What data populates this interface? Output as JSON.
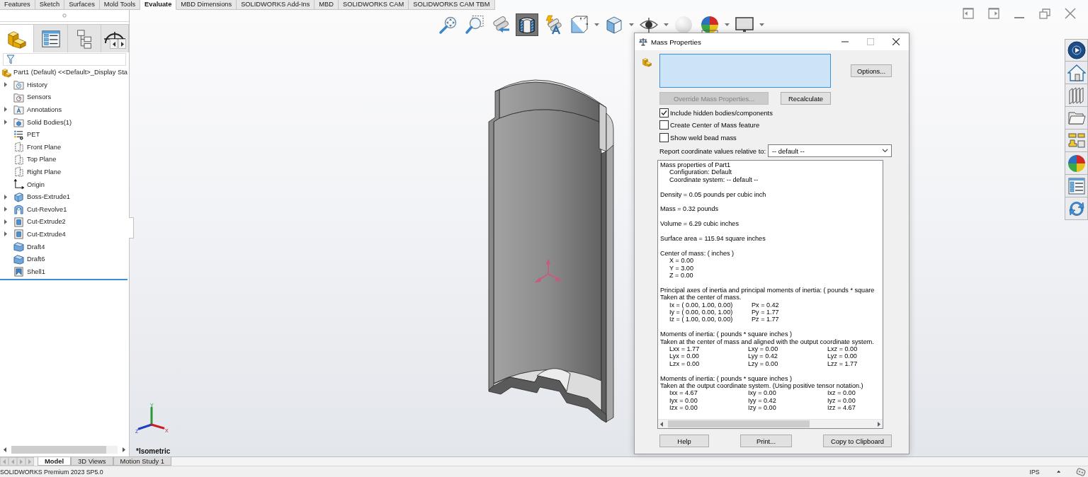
{
  "ribbon_tabs": [
    {
      "label": "Features",
      "selected": false
    },
    {
      "label": "Sketch",
      "selected": false
    },
    {
      "label": "Surfaces",
      "selected": false
    },
    {
      "label": "Mold Tools",
      "selected": false
    },
    {
      "label": "Evaluate",
      "selected": true
    },
    {
      "label": "MBD Dimensions",
      "selected": false
    },
    {
      "label": "SOLIDWORKS Add-Ins",
      "selected": false
    },
    {
      "label": "MBD",
      "selected": false
    },
    {
      "label": "SOLIDWORKS CAM",
      "selected": false
    },
    {
      "label": "SOLIDWORKS CAM TBM",
      "selected": false
    }
  ],
  "feature_panel": {
    "tabs": [
      {
        "kind": "features",
        "selected": true
      },
      {
        "kind": "properties",
        "selected": false
      },
      {
        "kind": "configurations",
        "selected": false
      },
      {
        "kind": "dimxpert",
        "selected": false
      }
    ],
    "root": {
      "label": "Part1 (Default) <<Default>_Display Sta"
    },
    "items": [
      {
        "label": "History",
        "kind": "history",
        "expanded": false
      },
      {
        "label": "Sensors",
        "kind": "sensors"
      },
      {
        "label": "Annotations",
        "kind": "annotations",
        "expanded": false
      },
      {
        "label": "Solid Bodies(1)",
        "kind": "bodies",
        "expanded": false
      },
      {
        "label": "PET",
        "kind": "material"
      },
      {
        "label": "Front Plane",
        "kind": "plane"
      },
      {
        "label": "Top Plane",
        "kind": "plane"
      },
      {
        "label": "Right Plane",
        "kind": "plane"
      },
      {
        "label": "Origin",
        "kind": "origin"
      },
      {
        "label": "Boss-Extrude1",
        "kind": "boss",
        "expanded": false
      },
      {
        "label": "Cut-Revolve1",
        "kind": "revolve",
        "expanded": false
      },
      {
        "label": "Cut-Extrude2",
        "kind": "cut",
        "expanded": false
      },
      {
        "label": "Cut-Extrude4",
        "kind": "cut",
        "expanded": false
      },
      {
        "label": "Draft4",
        "kind": "draft"
      },
      {
        "label": "Draft6",
        "kind": "draft"
      },
      {
        "label": "Shell1",
        "kind": "shell"
      }
    ]
  },
  "view_toolbar": [
    {
      "kind": "zoom_fit",
      "selected": false,
      "disabled": false,
      "menu": false
    },
    {
      "kind": "zoom_area",
      "selected": false,
      "disabled": false,
      "menu": false
    },
    {
      "kind": "previous_view",
      "selected": false,
      "disabled": false,
      "menu": false
    },
    {
      "kind": "section_view",
      "selected": true,
      "disabled": false,
      "menu": false
    },
    {
      "kind": "dynamic_annotation",
      "selected": false,
      "disabled": false,
      "menu": false
    },
    {
      "kind": "view_orientation",
      "selected": false,
      "disabled": false,
      "menu": true
    },
    {
      "kind": "display_style",
      "selected": false,
      "disabled": false,
      "menu": true
    },
    {
      "kind": "hide_show",
      "selected": false,
      "disabled": false,
      "menu": true
    },
    {
      "kind": "edit_appearance",
      "selected": false,
      "disabled": true,
      "menu": false
    },
    {
      "kind": "apply_scene",
      "selected": false,
      "disabled": false,
      "menu": true
    },
    {
      "kind": "view_settings",
      "selected": false,
      "disabled": false,
      "menu": true
    }
  ],
  "viewport": {
    "orientation": "*Isometric",
    "axes": [
      {
        "kind": "y",
        "label": "Y"
      },
      {
        "kind": "z",
        "label": "Z"
      },
      {
        "kind": "x",
        "label": "X"
      }
    ]
  },
  "dialog": {
    "title": "Mass Properties",
    "options_button": "Options...",
    "override_button": {
      "label": "Override Mass Properties...",
      "disabled": true
    },
    "recalculate_button": {
      "label": "Recalculate",
      "disabled": false
    },
    "checkboxes": [
      {
        "label": "Include hidden bodies/components",
        "checked": true
      },
      {
        "label": "Create Center of Mass feature",
        "checked": false
      },
      {
        "label": "Show weld bead mass",
        "checked": false
      }
    ],
    "coordinate_label": "Report coordinate values relative to:",
    "coordinate_select": {
      "value": "-- default --"
    },
    "report": [
      {
        "lines": [
          "Mass properties of Part1"
        ],
        "items": [
          "Configuration: Default",
          "Coordinate system: -- default --"
        ]
      },
      {
        "lines": [
          "Density = 0.05 pounds per cubic inch"
        ]
      },
      {
        "lines": [
          "Mass = 0.32 pounds"
        ]
      },
      {
        "lines": [
          "Volume = 6.29 cubic inches"
        ]
      },
      {
        "lines": [
          "Surface area = 115.94 square inches"
        ]
      },
      {
        "lines": [
          "Center of mass: ( inches )"
        ],
        "items": [
          "X = 0.00",
          "Y = 3.00",
          "Z = 0.00"
        ]
      },
      {
        "lines": [
          "Principal axes of inertia and principal moments of inertia: ( pounds * square",
          "Taken at the center of mass."
        ],
        "rows": [
          [
            "Ix = ( 0.00, 1.00, 0.00)",
            "Px = 0.42"
          ],
          [
            "Iy = ( 0.00, 0.00, 1.00)",
            "Py = 1.77"
          ],
          [
            "Iz = ( 1.00, 0.00, 0.00)",
            "Pz = 1.77"
          ]
        ]
      },
      {
        "lines": [
          "Moments of inertia: ( pounds * square inches )",
          "Taken at the center of mass and aligned with the output coordinate system."
        ],
        "rows": [
          [
            "Lxx = 1.77",
            "Lxy = 0.00",
            "Lxz = 0.00"
          ],
          [
            "Lyx = 0.00",
            "Lyy = 0.42",
            "Lyz = 0.00"
          ],
          [
            "Lzx = 0.00",
            "Lzy = 0.00",
            "Lzz = 1.77"
          ]
        ]
      },
      {
        "lines": [
          "Moments of inertia: ( pounds * square inches )",
          "Taken at the output coordinate system. (Using positive tensor notation.)"
        ],
        "rows": [
          [
            "Ixx = 4.67",
            "Ixy = 0.00",
            "Ixz = 0.00"
          ],
          [
            "Iyx = 0.00",
            "Iyy = 0.42",
            "Iyz = 0.00"
          ],
          [
            "Izx = 0.00",
            "Izy = 0.00",
            "Izz = 4.67"
          ]
        ]
      }
    ],
    "buttons": [
      "Help",
      "Print...",
      "Copy to Clipboard"
    ]
  },
  "bottom_tabs": [
    {
      "label": "Model",
      "selected": true
    },
    {
      "label": "3D Views",
      "selected": false
    },
    {
      "label": "Motion Study 1",
      "selected": false
    }
  ],
  "status_bar": {
    "product": "SOLIDWORKS Premium 2023 SP5.0",
    "units": "IPS"
  }
}
